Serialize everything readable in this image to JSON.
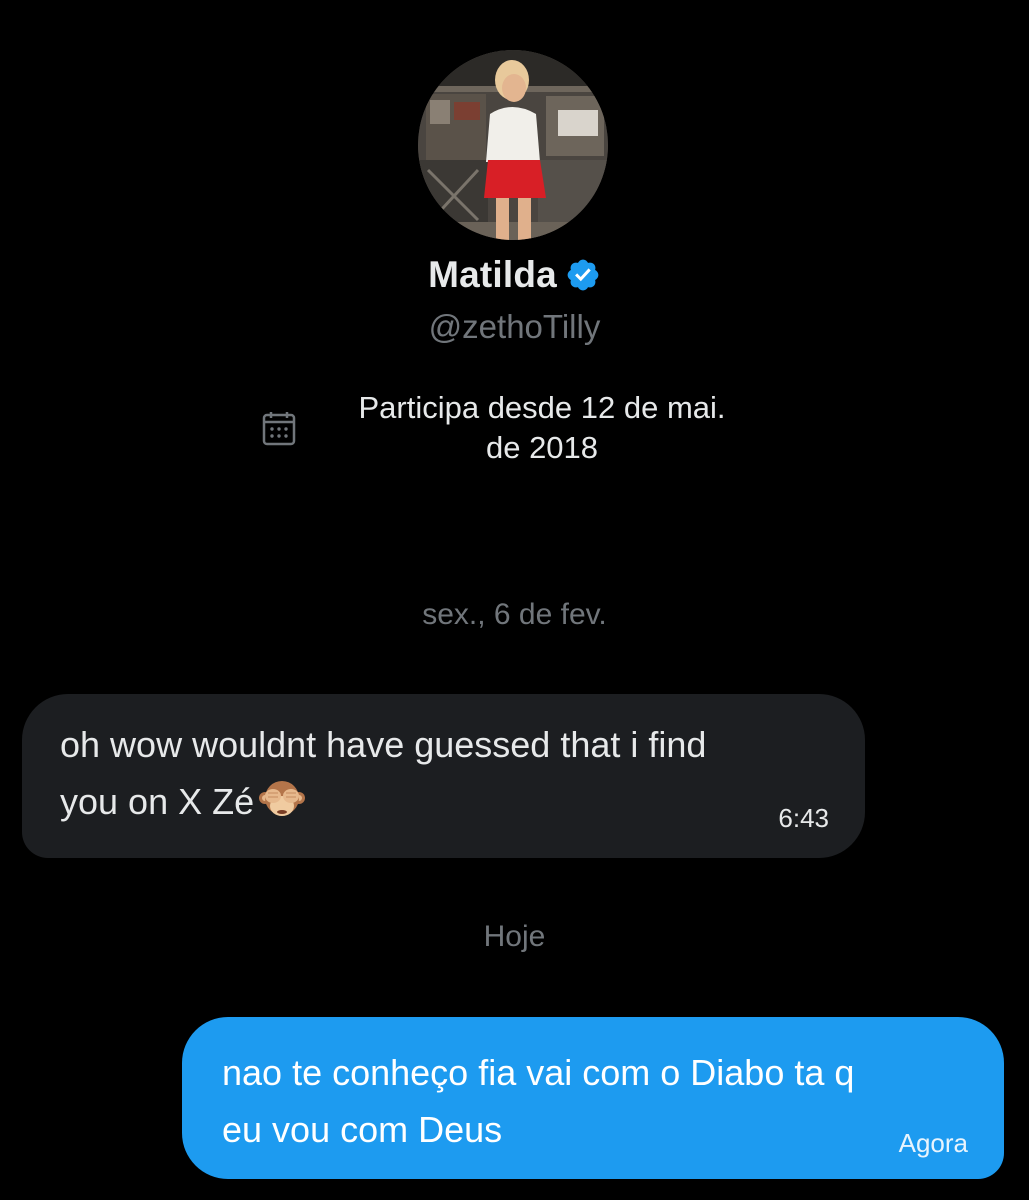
{
  "profile": {
    "name": "Matilda",
    "handle": "@zethoTilly",
    "verified": true,
    "joined_line1": "Participa desde 12 de mai.",
    "joined_line2": "de 2018",
    "avatar_icon": "profile-photo",
    "verified_icon": "verified-badge-icon",
    "calendar_icon": "calendar-icon"
  },
  "conversation": {
    "groups": [
      {
        "date_label": "sex., 6 de fev.",
        "messages": [
          {
            "direction": "received",
            "text_line1": "oh wow wouldnt have guessed that i find",
            "text_line2": "you on X  Zé",
            "emoji": "see-no-evil-monkey",
            "time": "6:43"
          }
        ]
      },
      {
        "date_label": "Hoje",
        "messages": [
          {
            "direction": "sent",
            "text_line1": "nao te conheço fia vai com o Diabo ta q",
            "text_line2": "eu vou com Deus",
            "time": "Agora"
          }
        ]
      }
    ]
  },
  "colors": {
    "background": "#000000",
    "received_bubble": "#1c1e21",
    "sent_bubble": "#1d9bf0",
    "secondary_text": "#71767b",
    "primary_text": "#e7e9ea",
    "verified": "#1d9bf0"
  }
}
